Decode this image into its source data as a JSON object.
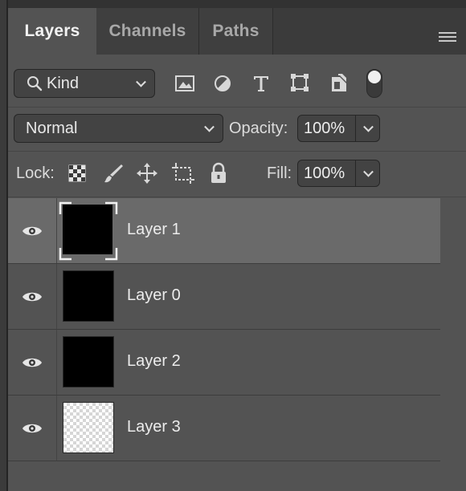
{
  "tabs": [
    {
      "label": "Layers",
      "active": true
    },
    {
      "label": "Channels",
      "active": false
    },
    {
      "label": "Paths",
      "active": false
    }
  ],
  "filter": {
    "kind_label": "Kind",
    "icons": [
      "image-filter-icon",
      "adjustment-filter-icon",
      "type-filter-icon",
      "shape-filter-icon",
      "smart-object-filter-icon",
      "filter-toggle-icon"
    ]
  },
  "blend": {
    "mode": "Normal",
    "opacity_label": "Opacity:",
    "opacity_value": "100%"
  },
  "lock": {
    "label": "Lock:",
    "icons": [
      "lock-transparent-pixels-icon",
      "lock-image-pixels-icon",
      "lock-position-icon",
      "lock-artboard-icon",
      "lock-all-icon"
    ],
    "fill_label": "Fill:",
    "fill_value": "100%"
  },
  "layers": [
    {
      "name": "Layer 1",
      "selected": true,
      "visible": true,
      "thumb": "black"
    },
    {
      "name": "Layer 0",
      "selected": false,
      "visible": true,
      "thumb": "black"
    },
    {
      "name": "Layer 2",
      "selected": false,
      "visible": true,
      "thumb": "black"
    },
    {
      "name": "Layer 3",
      "selected": false,
      "visible": true,
      "thumb": "transparent"
    }
  ],
  "colors": {
    "panel_bg": "#535353",
    "selected_row": "#6a6a6a",
    "tab_inactive": "#3f3f3f"
  }
}
